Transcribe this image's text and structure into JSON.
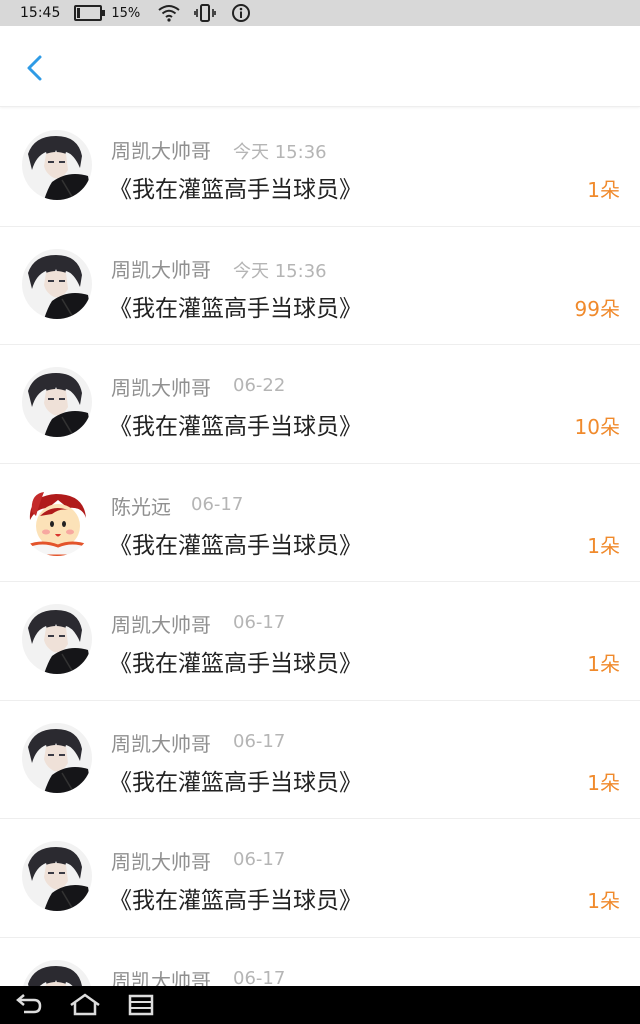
{
  "status_bar": {
    "time": "15:45",
    "battery_percent": "15%",
    "battery_level": 0.15,
    "icons": [
      "battery-icon",
      "wifi-icon",
      "vibrate-icon",
      "info-icon"
    ]
  },
  "header": {
    "back_icon": "chevron-left-icon",
    "accent_color": "#2f9be6"
  },
  "records": [
    {
      "name": "周凯大帅哥",
      "time": "今天 15:36",
      "book": "《我在灌篮高手当球员》",
      "amount": "1朵",
      "avatar": "dark-hair-boy-avatar"
    },
    {
      "name": "周凯大帅哥",
      "time": "今天 15:36",
      "book": "《我在灌篮高手当球员》",
      "amount": "99朵",
      "avatar": "dark-hair-boy-avatar"
    },
    {
      "name": "周凯大帅哥",
      "time": "06-22",
      "book": "《我在灌篮高手当球员》",
      "amount": "10朵",
      "avatar": "dark-hair-boy-avatar"
    },
    {
      "name": "陈光远",
      "time": "06-17",
      "book": "《我在灌篮高手当球员》",
      "amount": "1朵",
      "avatar": "cartoon-girl-avatar"
    },
    {
      "name": "周凯大帅哥",
      "time": "06-17",
      "book": "《我在灌篮高手当球员》",
      "amount": "1朵",
      "avatar": "dark-hair-boy-avatar"
    },
    {
      "name": "周凯大帅哥",
      "time": "06-17",
      "book": "《我在灌篮高手当球员》",
      "amount": "1朵",
      "avatar": "dark-hair-boy-avatar"
    },
    {
      "name": "周凯大帅哥",
      "time": "06-17",
      "book": "《我在灌篮高手当球员》",
      "amount": "1朵",
      "avatar": "dark-hair-boy-avatar"
    },
    {
      "name": "周凯大帅哥",
      "time": "06-17",
      "book": "",
      "amount": "",
      "avatar": "dark-hair-boy-avatar"
    }
  ],
  "colors": {
    "amount": "#f08a2c",
    "name": "#909090",
    "time": "#b5b5b5",
    "book": "#222222"
  },
  "nav_bar": {
    "icons": [
      "back-nav-icon",
      "home-nav-icon",
      "recent-apps-icon"
    ]
  }
}
